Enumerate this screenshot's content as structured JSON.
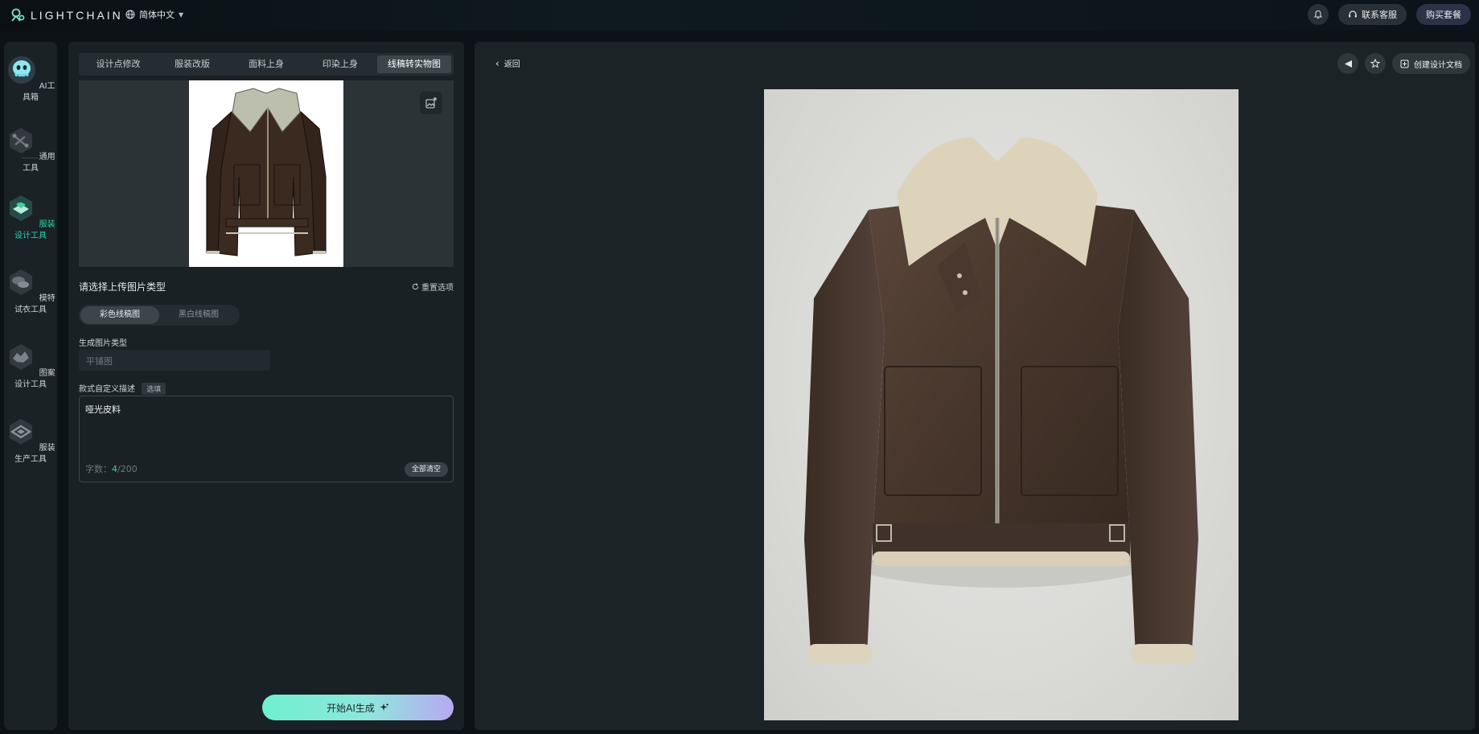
{
  "app": {
    "logo_text": "LIGHTCHAIN",
    "language": "简体中文"
  },
  "topbar": {
    "support_label": "联系客服",
    "buy_label": "购买套餐"
  },
  "nav": {
    "items": [
      {
        "label": "AI工具箱",
        "icon": "mascot-icon"
      },
      {
        "label": "通用工具",
        "icon": "tools-icon"
      },
      {
        "label": "服装设计工具",
        "icon": "fashion-design-icon",
        "active": true
      },
      {
        "label": "模特试衣工具",
        "icon": "model-tryon-icon"
      },
      {
        "label": "图案设计工具",
        "icon": "pattern-design-icon"
      },
      {
        "label": "服装生产工具",
        "icon": "production-icon"
      }
    ]
  },
  "panel": {
    "tabs": [
      "设计点修改",
      "服装改版",
      "面料上身",
      "印染上身",
      "线稿转实物图"
    ],
    "active_tab": "线稿转实物图",
    "upload_type_title": "请选择上传图片类型",
    "reset_label": "重置选项",
    "upload_types": [
      "彩色线稿图",
      "黑白线稿图"
    ],
    "selected_upload_type": "彩色线稿图",
    "gen_type_label": "生成图片类型",
    "gen_type_placeholder": "平铺图",
    "desc_label": "款式自定义描述",
    "desc_optional": "选填",
    "desc_value": "哑光皮料",
    "count_prefix": "字数：",
    "count_current": "4",
    "count_max": "/200",
    "clear_label": "全部清空",
    "generate_label": "开始AI生成"
  },
  "result": {
    "back_label": "返回",
    "create_doc_label": "创建设计文档"
  },
  "colors": {
    "accent": "#2ed1ac",
    "gradient_start": "#6ff0cf",
    "gradient_end": "#b7a9f2"
  }
}
